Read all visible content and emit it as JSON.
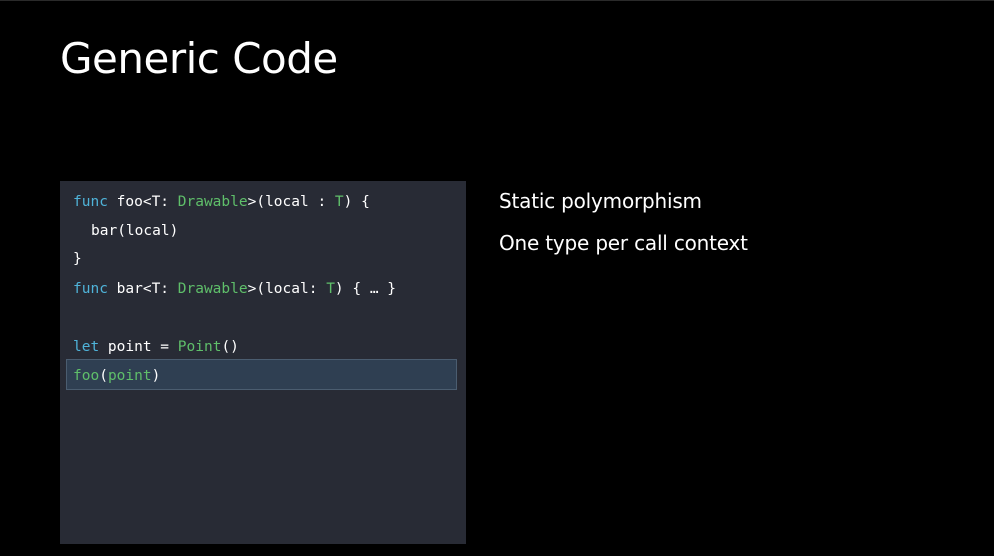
{
  "slide": {
    "title": "Generic Code"
  },
  "bullets": [
    "Static polymorphism",
    "One type per call context"
  ],
  "code": {
    "line1": {
      "kw": "func",
      "a": " foo<T: ",
      "ty1": "Drawable",
      "b": ">(local : ",
      "ty2": "T",
      "c": ") {"
    },
    "line2": {
      "text": "bar(local)"
    },
    "line3": {
      "text": "}"
    },
    "line4": {
      "kw": "func",
      "a": " bar<T: ",
      "ty1": "Drawable",
      "b": ">(local: ",
      "ty2": "T",
      "c": ") { … }"
    },
    "line5": {
      "kw": "let",
      "a": " point = ",
      "ty1": "Point",
      "b": "()"
    },
    "line6": {
      "fn": "foo",
      "a": "(",
      "arg": "point",
      "b": ")"
    }
  },
  "colors": {
    "keyword": "#4fb3d9",
    "type": "#5fbf6a",
    "panel_background": "#282b35",
    "highlight_background": "#2f3f52"
  }
}
